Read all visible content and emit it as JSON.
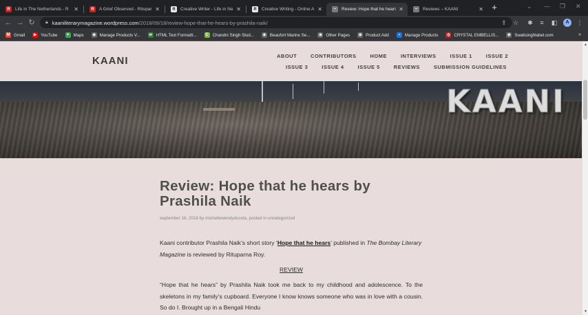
{
  "browser": {
    "tabs": [
      {
        "title": "Life in The Netherlands - R",
        "favicon_color": "#c5221f",
        "favicon_glyph": "R"
      },
      {
        "title": "A Grief Observed - Ritupar",
        "favicon_color": "#c5221f",
        "favicon_glyph": "R"
      },
      {
        "title": "Creative Writer - Life in Ne",
        "favicon_color": "#e8eaed",
        "favicon_glyph": "R"
      },
      {
        "title": "Creative Writing - Online A",
        "favicon_color": "#e8eaed",
        "favicon_glyph": "R"
      },
      {
        "title": "Review: Hope that he hears",
        "favicon_color": "#7a7a7a",
        "favicon_glyph": "~",
        "active": true
      },
      {
        "title": "Reviews – KAANI",
        "favicon_color": "#7a7a7a",
        "favicon_glyph": "~"
      }
    ],
    "url_host": "kaaniliterarymagazine.wordpress.com",
    "url_path": "/2018/09/18/review-hope-that-he-hears-by-prashila-naik/",
    "profile_initial": "A",
    "bookmarks": [
      {
        "label": "Gmail",
        "color": "#ea4335",
        "glyph": "M"
      },
      {
        "label": "YouTube",
        "color": "#ff0000",
        "glyph": "▶"
      },
      {
        "label": "Maps",
        "color": "#34a853",
        "glyph": "✦"
      },
      {
        "label": "Manage Products V...",
        "color": "#5f6368",
        "glyph": "◉"
      },
      {
        "label": "HTML Text Formatti...",
        "color": "#2e7d32",
        "glyph": "w"
      },
      {
        "label": "Chandni Singh Stud...",
        "color": "#7cb342",
        "glyph": "C"
      },
      {
        "label": "Beaufort Marine Se...",
        "color": "#5f6368",
        "glyph": "◉"
      },
      {
        "label": "Other Pages",
        "color": "#5f6368",
        "glyph": "◉"
      },
      {
        "label": "Product Add",
        "color": "#5f6368",
        "glyph": "◉"
      },
      {
        "label": "Manage Products",
        "color": "#1a73e8",
        "glyph": "▪"
      },
      {
        "label": "CRYSTAL EMBELLIS...",
        "color": "#c5221f",
        "glyph": "◍"
      },
      {
        "label": "Swatisinghlabel.com",
        "color": "#5f6368",
        "glyph": "◉"
      }
    ],
    "bookmarks_more": "»"
  },
  "site": {
    "title": "KAANI",
    "hero_logo": "KAANI",
    "nav_row1": [
      "ABOUT",
      "CONTRIBUTORS",
      "HOME",
      "INTERVIEWS",
      "ISSUE 1",
      "ISSUE 2"
    ],
    "nav_row2": [
      "ISSUE 3",
      "ISSUE 4",
      "ISSUE 5",
      "REVIEWS",
      "SUBMISSION GUIDELINES"
    ]
  },
  "article": {
    "title": "Review: Hope that he hears by Prashila Naik",
    "meta": "september 18, 2018 by michellewendydcosta, posted in uncategorized",
    "intro_before": "Kaani contributor Prashila Naik’s short story ‘",
    "intro_link": "Hope that he hears",
    "intro_mid": "’ published in ",
    "intro_pub": "The Bombay Literary Magazine",
    "intro_after": " is reviewed by Rituparna Roy.",
    "review_heading": "REVIEW",
    "body": "“Hope that he hears” by Prashila Naik took me back to my childhood and adolescence. To the skeletons in my family’s cupboard. Everyone I know knows someone who was in love with a cousin. So do I. Brought up in a Bengali Hindu"
  }
}
